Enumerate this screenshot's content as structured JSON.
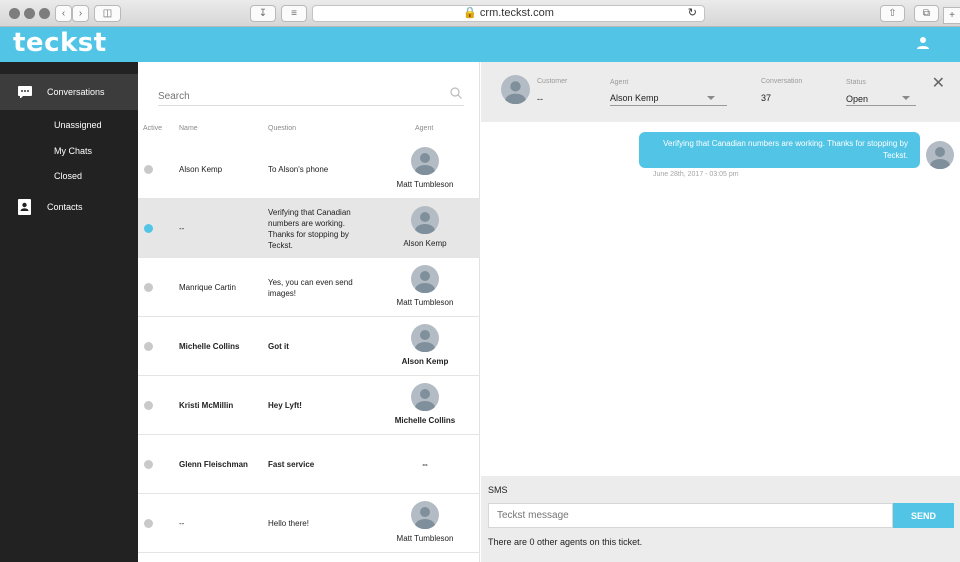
{
  "browser": {
    "url": "crm.teckst.com"
  },
  "app": {
    "logo": "teckst",
    "accent": "#52c5e6"
  },
  "sidebar": {
    "conversations": "Conversations",
    "sub": [
      "Unassigned",
      "My Chats",
      "Closed"
    ],
    "contacts": "Contacts"
  },
  "list": {
    "search_placeholder": "Search",
    "columns": {
      "active": "Active",
      "name": "Name",
      "question": "Question",
      "agent": "Agent"
    },
    "rows": [
      {
        "name": "Alson Kemp",
        "question": "To Alson's phone",
        "agent": "Matt Tumbleson",
        "active": false
      },
      {
        "name": "--",
        "question": "Verifying that Canadian numbers are working. Thanks for stopping by Teckst.",
        "agent": "Alson Kemp",
        "active": true
      },
      {
        "name": "Manrique Cartin",
        "question": "Yes, you can even send images!",
        "agent": "Matt Tumbleson",
        "active": false
      },
      {
        "name": "Michelle Collins",
        "question": "Got it",
        "agent": "Alson Kemp",
        "active": false
      },
      {
        "name": "Kristi McMillin",
        "question": "Hey Lyft!",
        "agent": "Michelle Collins",
        "active": false
      },
      {
        "name": "Glenn Fleischman",
        "question": "Fast service",
        "agent": "--",
        "active": false
      },
      {
        "name": "--",
        "question": "Hello there!",
        "agent": "Matt Tumbleson",
        "active": false
      }
    ]
  },
  "detail": {
    "customer_label": "Customer",
    "customer_value": "--",
    "agent_label": "Agent",
    "agent_value": "Alson Kemp",
    "conversation_label": "Conversation",
    "conversation_value": "37",
    "status_label": "Status",
    "status_value": "Open",
    "message_text": "Verifying that Canadian numbers are working. Thanks for stopping by Teckst.",
    "message_time": "June 28th, 2017 - 03:05 pm",
    "sms_label": "SMS",
    "message_placeholder": "Teckst message",
    "send_label": "SEND",
    "agents_note": "There are 0 other agents on this ticket."
  }
}
